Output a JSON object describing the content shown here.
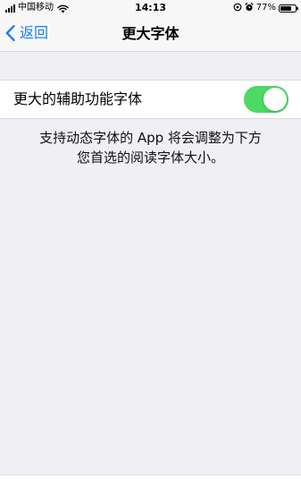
{
  "status_bar": {
    "carrier": "中国移动",
    "time": "14:13",
    "battery_percent": "77%",
    "battery_level": 0.77,
    "icons": [
      "signal-icon",
      "wifi-icon",
      "location-icon",
      "alarm-icon",
      "battery-icon"
    ]
  },
  "nav": {
    "back_label": "返回",
    "title": "更大字体"
  },
  "setting": {
    "label": "更大的辅助功能字体",
    "enabled": true,
    "toggle_color": "#4cd964"
  },
  "description": {
    "line1": "支持动态字体的 App 将会调整为下方",
    "line2": "您首选的阅读字体大小。"
  },
  "colors": {
    "accent": "#1d7cf2",
    "background": "#efeff4",
    "toggle_on": "#4cd964"
  }
}
